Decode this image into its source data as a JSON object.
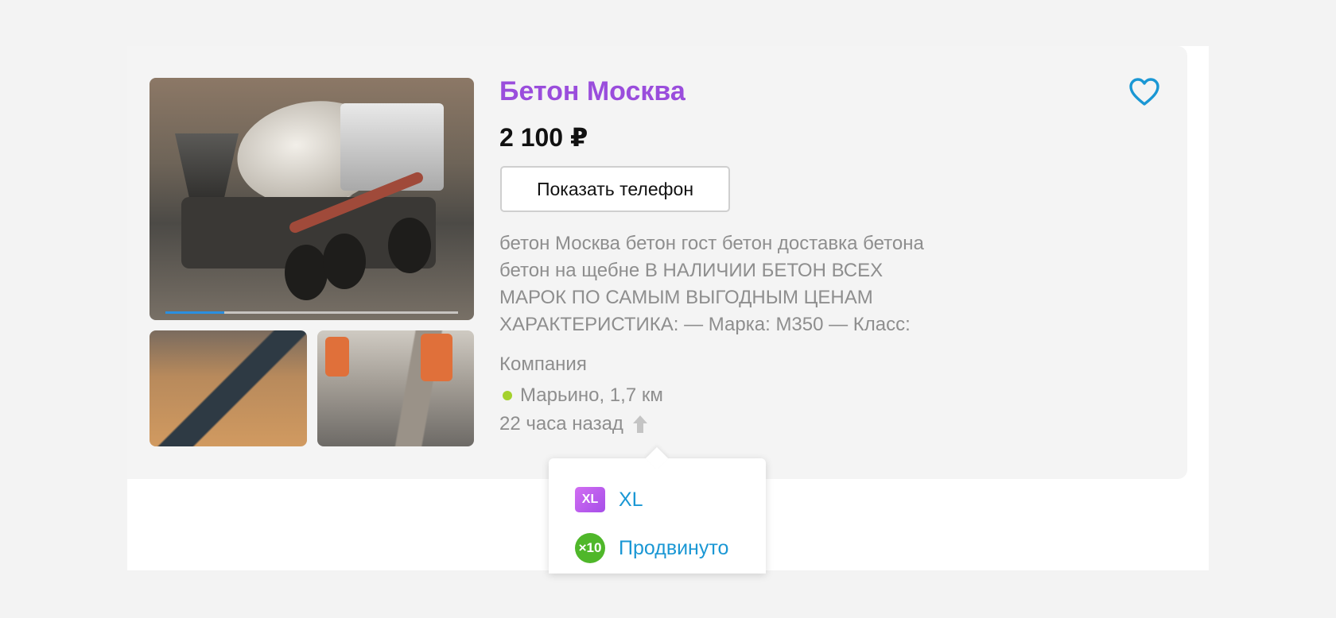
{
  "listing": {
    "title": "Бетон Москва",
    "price": "2 100 ₽",
    "show_phone_label": "Показать телефон",
    "description_lines": [
      "бетон Москва бетон гост бетон доставка бетона",
      "бетон на щебне В НАЛИЧИИ БЕТОН ВСЕХ",
      "МАРОК ПО САМЫМ ВЫГОДНЫМ ЦЕНАМ",
      "ХАРАКТЕРИСТИКА: — Марка: М350 — Класс:"
    ],
    "seller_type": "Компания",
    "location": "Марьино, 1,7 км",
    "posted": "22 часа назад",
    "gallery_progress": 0.2,
    "colors": {
      "title": "#9a4ddc",
      "accent_link": "#1a97d4",
      "metro_dot": "#a4d12c"
    }
  },
  "promo_popup": {
    "items": [
      {
        "badge": "XL",
        "label": "XL"
      },
      {
        "badge": "×10",
        "label": "Продвинуто"
      }
    ]
  }
}
